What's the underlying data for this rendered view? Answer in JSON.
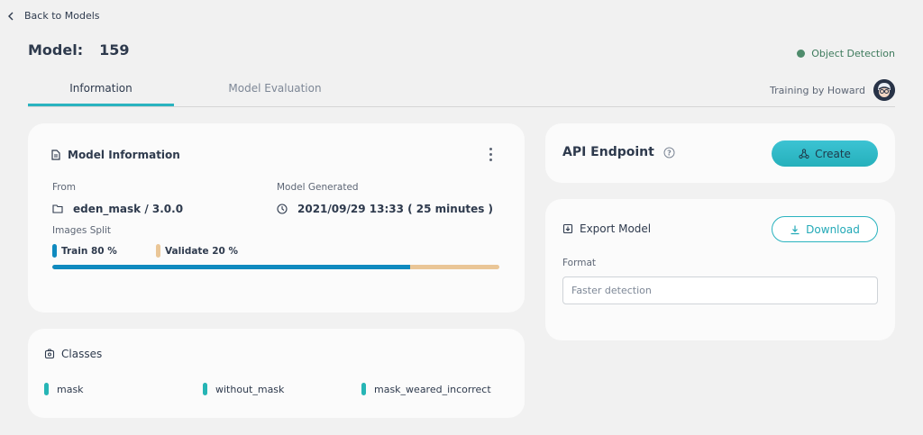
{
  "nav": {
    "back_label": "Back to Models"
  },
  "header": {
    "model_label": "Model:",
    "model_id": "159",
    "model_type": "Object Detection"
  },
  "tabs": [
    {
      "label": "Information",
      "active": true
    },
    {
      "label": "Model Evaluation",
      "active": false
    }
  ],
  "trainer": {
    "label": "Training by Howard"
  },
  "model_info": {
    "title": "Model Information",
    "from_label": "From",
    "from_value": "eden_mask / 3.0.0",
    "generated_label": "Model Generated",
    "generated_value": "2021/09/29 13:33 ( 25 minutes )",
    "split_label": "Images Split",
    "train_label": "Train 80 %",
    "validate_label": "Validate 20 %",
    "train_fraction": 0.8
  },
  "classes": {
    "title": "Classes",
    "items": [
      "mask",
      "without_mask",
      "mask_weared_incorrect"
    ]
  },
  "api": {
    "title": "API Endpoint",
    "create_label": "Create"
  },
  "export": {
    "title": "Export Model",
    "download_label": "Download",
    "format_label": "Format",
    "format_value": "Faster detection"
  },
  "colors": {
    "accent": "#2ab3bf",
    "train": "#0f8abf",
    "validate": "#eac697",
    "class_marker": "#26b5b5",
    "badge": "#4f8c6c"
  }
}
